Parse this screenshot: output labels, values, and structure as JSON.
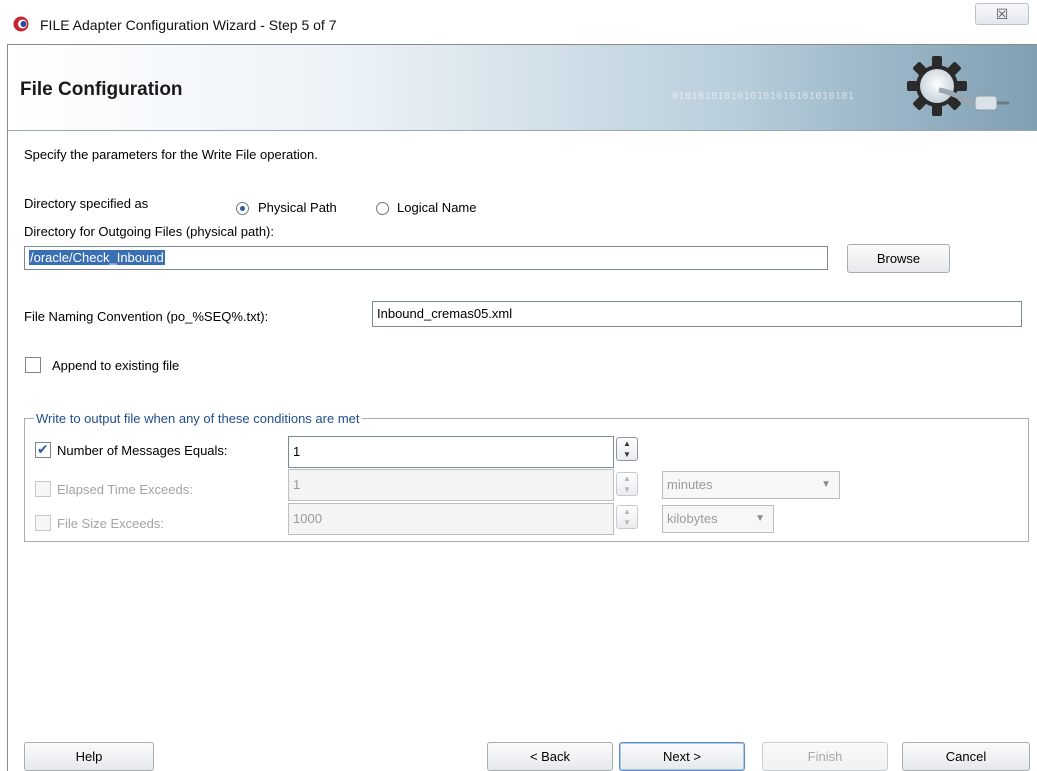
{
  "window": {
    "title": "FILE Adapter Configuration Wizard - Step 5 of 7",
    "close_glyph": "☒"
  },
  "header": {
    "title": "File Configuration",
    "binary_text": "0101010101010101010101010101"
  },
  "description": "Specify the parameters for the Write File operation.",
  "directory": {
    "label": "Directory specified as",
    "options": [
      "Physical Path",
      "Logical Name"
    ],
    "selected": "Physical Path",
    "path_label": "Directory for Outgoing Files (physical path):",
    "path_value": "/oracle/Check_Inbound",
    "browse_label": "Browse"
  },
  "naming": {
    "label": "File Naming Convention (po_%SEQ%.txt):",
    "value": "Inbound_cremas05.xml"
  },
  "append": {
    "label": "Append to existing file",
    "checked": false
  },
  "conditions": {
    "legend": "Write to output file when any of these conditions are met",
    "messages": {
      "label": "Number of Messages Equals:",
      "value": "1",
      "checked": true
    },
    "elapsed": {
      "label": "Elapsed Time Exceeds:",
      "value": "1",
      "unit": "minutes",
      "checked": false
    },
    "filesize": {
      "label": "File Size Exceeds:",
      "value": "1000",
      "unit": "kilobytes",
      "checked": false
    }
  },
  "footer": {
    "help": "Help",
    "back": "< Back",
    "next": "Next >",
    "finish": "Finish",
    "cancel": "Cancel"
  }
}
